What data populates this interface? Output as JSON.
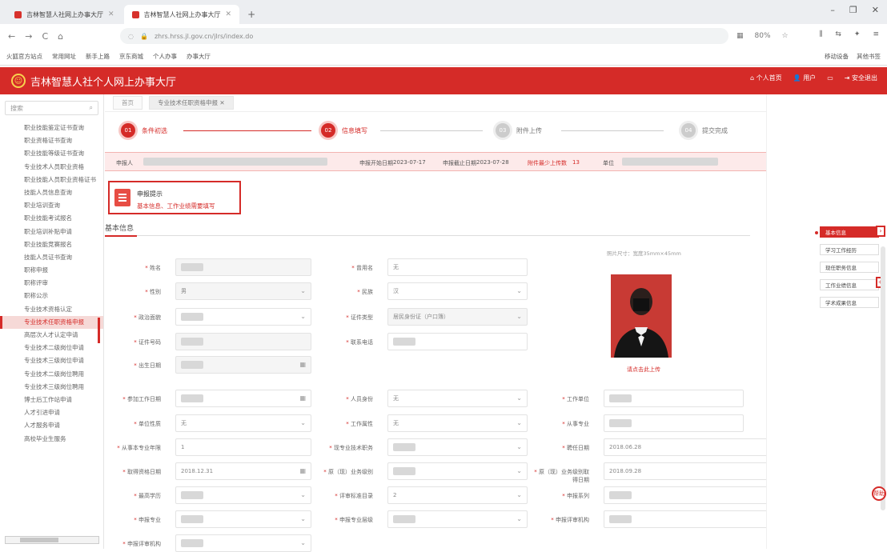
{
  "browser": {
    "tabs": [
      {
        "label": "吉林智慧人社网上办事大厅",
        "active": false
      },
      {
        "label": "吉林智慧人社网上办事大厅",
        "active": true
      }
    ],
    "new_tab": "+",
    "window_controls": [
      "–",
      "❐",
      "✕"
    ],
    "nav": {
      "back": "←",
      "forward": "→",
      "reload": "C",
      "home": "⌂"
    },
    "url": "zhrs.hrss.jl.gov.cn/jlrs/index.do",
    "zoom": "80%",
    "bookmarks": [
      "火狐官方站点",
      "常用网址",
      "新手上路",
      "京东商城",
      "个人办事",
      "办事大厅"
    ],
    "bookmarks_right": [
      "移动设备",
      "其他书签"
    ]
  },
  "app": {
    "title": "吉林智慧人社个人网上办事大厅",
    "logo": "☺",
    "header_right": {
      "home": "个人首页",
      "user_icon": "person-icon",
      "user_name": "用户",
      "logout": "安全退出"
    }
  },
  "sidebar": {
    "search_placeholder": "搜索",
    "items": [
      "职业技能鉴定证书查询",
      "职业资格证书查询",
      "职业技能等级证书查询",
      "专业技术人员职业资格",
      "职业技能人员职业资格证书",
      "技能人员信息查询",
      "职业培训查询",
      "职业技能考试报名",
      "职业培训补贴申请",
      "职业技能竞赛报名",
      "技能人员证书查询",
      "职称申报",
      "职称评审",
      "职称公示",
      "专业技术资格认定",
      "专业技术任职资格申报",
      "高层次人才认定申请",
      "专业技术二级岗位申请",
      "专业技术三级岗位申请",
      "专业技术二级岗位聘用",
      "专业技术三级岗位聘用",
      "博士后工作站申请",
      "人才引进申请",
      "人才服务申请",
      "高校毕业生服务"
    ],
    "active_index": 15
  },
  "page_tabs": [
    "首页",
    "专业技术任职资格申报"
  ],
  "steps": [
    {
      "num": "01",
      "label": "条件初选",
      "state": "done"
    },
    {
      "num": "02",
      "label": "信息填写",
      "state": "current"
    },
    {
      "num": "03",
      "label": "附件上传",
      "state": "todo"
    },
    {
      "num": "04",
      "label": "提交完成",
      "state": "todo"
    }
  ],
  "infobar": {
    "applicant_label": "申报人",
    "start_label": "申报开始日期",
    "start_value": "2023-07-17",
    "end_label": "申报截止日期",
    "end_value": "2023-07-28",
    "attach_label": "附件最少上传数",
    "attach_value": "13",
    "unit_label": "单位"
  },
  "apply": {
    "title": "申报提示",
    "text": "基本信息、工作业绩需要填写"
  },
  "section_title": "基本信息",
  "form": {
    "name": {
      "label": "姓名",
      "value": ""
    },
    "former_name": {
      "label": "曾用名",
      "value": "无"
    },
    "gender": {
      "label": "性别",
      "value": "男"
    },
    "nation": {
      "label": "民族",
      "value": "汉"
    },
    "political": {
      "label": "政治面貌",
      "value": ""
    },
    "id_type": {
      "label": "证件类型",
      "value": "居民身份证（户口簿）"
    },
    "id_number": {
      "label": "证件号码",
      "value": ""
    },
    "contact": {
      "label": "联系电话",
      "value": ""
    },
    "birthday": {
      "label": "出生日期",
      "value": ""
    },
    "work_start": {
      "label": "参加工作日期",
      "value": ""
    },
    "person_type": {
      "label": "人员身份",
      "value": "无"
    },
    "work_unit": {
      "label": "工作单位",
      "value": ""
    },
    "unit_nature": {
      "label": "单位性质",
      "value": "无"
    },
    "work_category": {
      "label": "工作属性",
      "value": "无"
    },
    "specialty": {
      "label": "从事专业",
      "value": ""
    },
    "years": {
      "label": "从事本专业年限",
      "value": "1"
    },
    "current_title": {
      "label": "现专业技术职务",
      "value": ""
    },
    "appoint_date": {
      "label": "聘任日期",
      "value": "2018.06.28"
    },
    "qualify_date": {
      "label": "取得资格日期",
      "value": "2018.12.31"
    },
    "prev_title": {
      "label": "原（现）业务级别",
      "value": ""
    },
    "prev_date": {
      "label": "原（现）业务级别取得日期",
      "value": "2018.09.28"
    },
    "education": {
      "label": "最高学历",
      "value": ""
    },
    "degree_date": {
      "label": "评审标准目录",
      "value": "2"
    },
    "post": {
      "label": "申报系列",
      "value": ""
    },
    "major": {
      "label": "申报专业",
      "value": ""
    },
    "major_level": {
      "label": "申报专业层级",
      "value": ""
    },
    "review_org": {
      "label": "申报评审机构",
      "value": ""
    },
    "work_major": {
      "label": "申报评审机构",
      "value": ""
    }
  },
  "photo": {
    "note": "照片尺寸：宽度35mm×45mm",
    "upload": "请点击此上传"
  },
  "right_panel": {
    "items": [
      "基本信息",
      "学习工作经历",
      "现任职务信息",
      "工作业绩信息",
      "学术成果信息"
    ],
    "active_index": 0,
    "side_buttons": [
      "›",
      "+"
    ],
    "help": "帮助"
  }
}
